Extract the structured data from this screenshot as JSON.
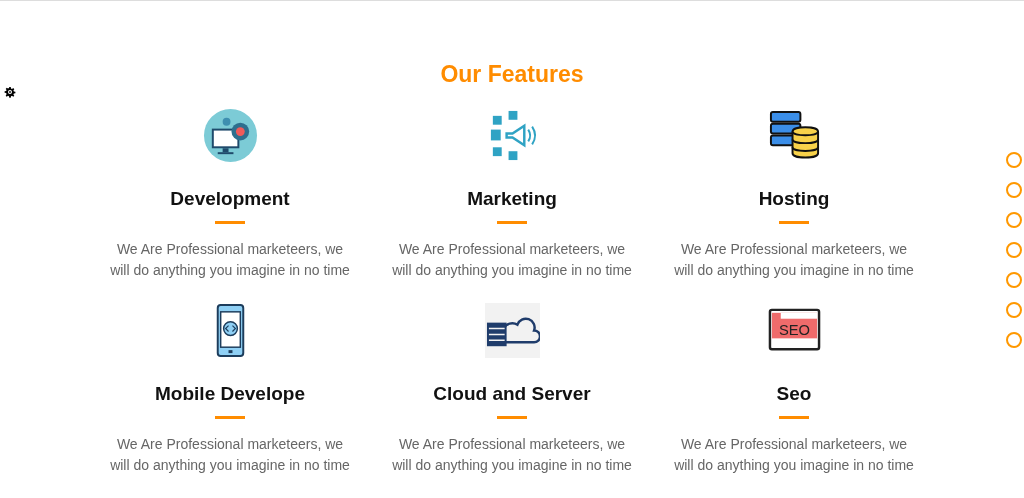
{
  "section": {
    "title": "Our Features"
  },
  "features": [
    {
      "kind": "development",
      "title": "Development",
      "text": "We Are Professional marketeers, we will do anything you imagine in no time"
    },
    {
      "kind": "marketing",
      "title": "Marketing",
      "text": "We Are Professional marketeers, we will do anything you imagine in no time"
    },
    {
      "kind": "hosting",
      "title": "Hosting",
      "text": "We Are Professional marketeers, we will do anything you imagine in no time"
    },
    {
      "kind": "mobile",
      "title": "Mobile Develope",
      "text": "We Are Professional marketeers, we will do anything you imagine in no time"
    },
    {
      "kind": "cloud",
      "title": "Cloud and Server",
      "text": "We Are Professional marketeers, we will do anything you imagine in no time"
    },
    {
      "kind": "seo",
      "title": "Seo",
      "icon_text": "SEO",
      "text": "We Are Professional marketeers, we will do anything you imagine in no time"
    }
  ],
  "page_dots": [
    {
      "selected": false
    },
    {
      "selected": false
    },
    {
      "selected": false
    },
    {
      "selected": false
    },
    {
      "selected": false
    },
    {
      "selected": false
    },
    {
      "selected": false
    }
  ]
}
